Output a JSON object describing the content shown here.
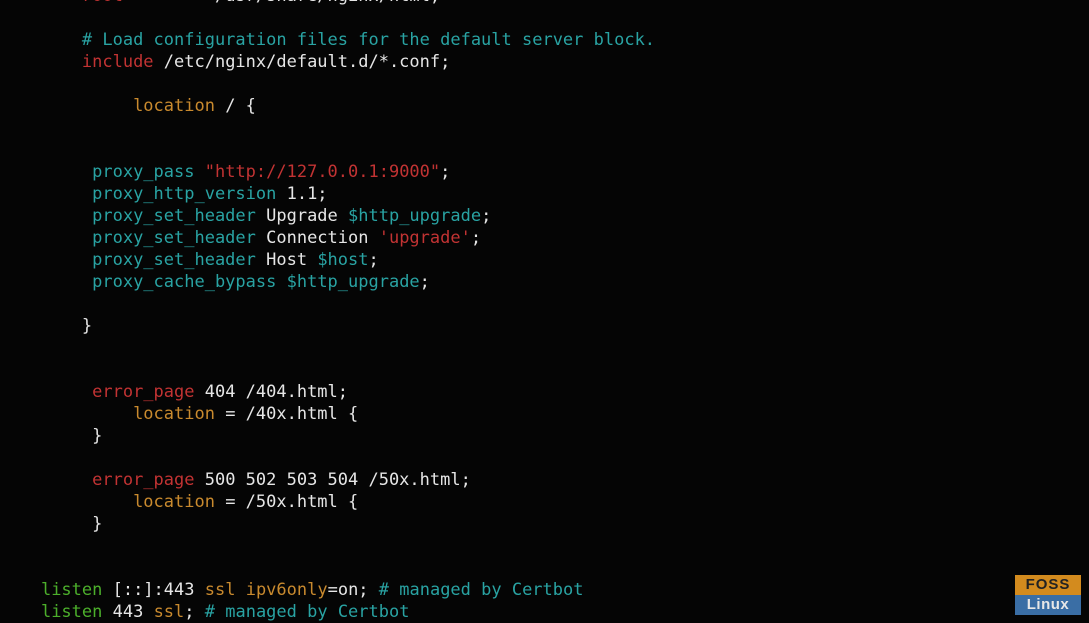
{
  "lines": [
    [
      {
        "cls": "w",
        "t": "        "
      },
      {
        "cls": "rd",
        "t": "root"
      },
      {
        "cls": "w",
        "t": "         /usr/share/nginx/html;"
      }
    ],
    [
      {
        "cls": "w",
        "t": ""
      }
    ],
    [
      {
        "cls": "w",
        "t": "        "
      },
      {
        "cls": "cy",
        "t": "# Load configuration files for the default server block."
      }
    ],
    [
      {
        "cls": "w",
        "t": "        "
      },
      {
        "cls": "rd",
        "t": "include"
      },
      {
        "cls": "w",
        "t": " /etc/nginx/default.d/*.conf;"
      }
    ],
    [
      {
        "cls": "w",
        "t": ""
      }
    ],
    [
      {
        "cls": "w",
        "t": "             "
      },
      {
        "cls": "or",
        "t": "location"
      },
      {
        "cls": "w",
        "t": " / {"
      }
    ],
    [
      {
        "cls": "w",
        "t": ""
      }
    ],
    [
      {
        "cls": "w",
        "t": ""
      }
    ],
    [
      {
        "cls": "w",
        "t": "         "
      },
      {
        "cls": "cy",
        "t": "proxy_pass"
      },
      {
        "cls": "w",
        "t": " "
      },
      {
        "cls": "rd",
        "t": "\"http://127.0.0.1:9000\""
      },
      {
        "cls": "w",
        "t": ";"
      }
    ],
    [
      {
        "cls": "w",
        "t": "         "
      },
      {
        "cls": "cy",
        "t": "proxy_http_version"
      },
      {
        "cls": "w",
        "t": " 1.1;"
      }
    ],
    [
      {
        "cls": "w",
        "t": "         "
      },
      {
        "cls": "cy",
        "t": "proxy_set_header"
      },
      {
        "cls": "w",
        "t": " Upgrade "
      },
      {
        "cls": "cy",
        "t": "$http_upgrade"
      },
      {
        "cls": "w",
        "t": ";"
      }
    ],
    [
      {
        "cls": "w",
        "t": "         "
      },
      {
        "cls": "cy",
        "t": "proxy_set_header"
      },
      {
        "cls": "w",
        "t": " Connection "
      },
      {
        "cls": "rd",
        "t": "'upgrade'"
      },
      {
        "cls": "w",
        "t": ";"
      }
    ],
    [
      {
        "cls": "w",
        "t": "         "
      },
      {
        "cls": "cy",
        "t": "proxy_set_header"
      },
      {
        "cls": "w",
        "t": " Host "
      },
      {
        "cls": "cy",
        "t": "$host"
      },
      {
        "cls": "w",
        "t": ";"
      }
    ],
    [
      {
        "cls": "w",
        "t": "         "
      },
      {
        "cls": "cy",
        "t": "proxy_cache_bypass"
      },
      {
        "cls": "w",
        "t": " "
      },
      {
        "cls": "cy",
        "t": "$http_upgrade"
      },
      {
        "cls": "w",
        "t": ";"
      }
    ],
    [
      {
        "cls": "w",
        "t": ""
      }
    ],
    [
      {
        "cls": "w",
        "t": "        }"
      }
    ],
    [
      {
        "cls": "w",
        "t": ""
      }
    ],
    [
      {
        "cls": "w",
        "t": ""
      }
    ],
    [
      {
        "cls": "w",
        "t": "         "
      },
      {
        "cls": "rd",
        "t": "error_page"
      },
      {
        "cls": "w",
        "t": " 404 /404.html;"
      }
    ],
    [
      {
        "cls": "w",
        "t": "             "
      },
      {
        "cls": "or",
        "t": "location"
      },
      {
        "cls": "w",
        "t": " = /40x.html {"
      }
    ],
    [
      {
        "cls": "w",
        "t": "         }"
      }
    ],
    [
      {
        "cls": "w",
        "t": ""
      }
    ],
    [
      {
        "cls": "w",
        "t": "         "
      },
      {
        "cls": "rd",
        "t": "error_page"
      },
      {
        "cls": "w",
        "t": " 500 502 503 504 /50x.html;"
      }
    ],
    [
      {
        "cls": "w",
        "t": "             "
      },
      {
        "cls": "or",
        "t": "location"
      },
      {
        "cls": "w",
        "t": " = /50x.html {"
      }
    ],
    [
      {
        "cls": "w",
        "t": "         }"
      }
    ],
    [
      {
        "cls": "w",
        "t": ""
      }
    ],
    [
      {
        "cls": "w",
        "t": ""
      }
    ],
    [
      {
        "cls": "w",
        "t": "    "
      },
      {
        "cls": "gn",
        "t": "listen"
      },
      {
        "cls": "w",
        "t": " [::]:443 "
      },
      {
        "cls": "or",
        "t": "ssl"
      },
      {
        "cls": "w",
        "t": " "
      },
      {
        "cls": "or",
        "t": "ipv6only"
      },
      {
        "cls": "w",
        "t": "=on; "
      },
      {
        "cls": "cy",
        "t": "# managed by Certbot"
      }
    ],
    [
      {
        "cls": "w",
        "t": "    "
      },
      {
        "cls": "gn",
        "t": "listen"
      },
      {
        "cls": "w",
        "t": " 443 "
      },
      {
        "cls": "or",
        "t": "ssl"
      },
      {
        "cls": "w",
        "t": "; "
      },
      {
        "cls": "cy",
        "t": "# managed by Certbot"
      }
    ]
  ],
  "watermark": {
    "foss": "FOSS",
    "linux": "Linux"
  }
}
